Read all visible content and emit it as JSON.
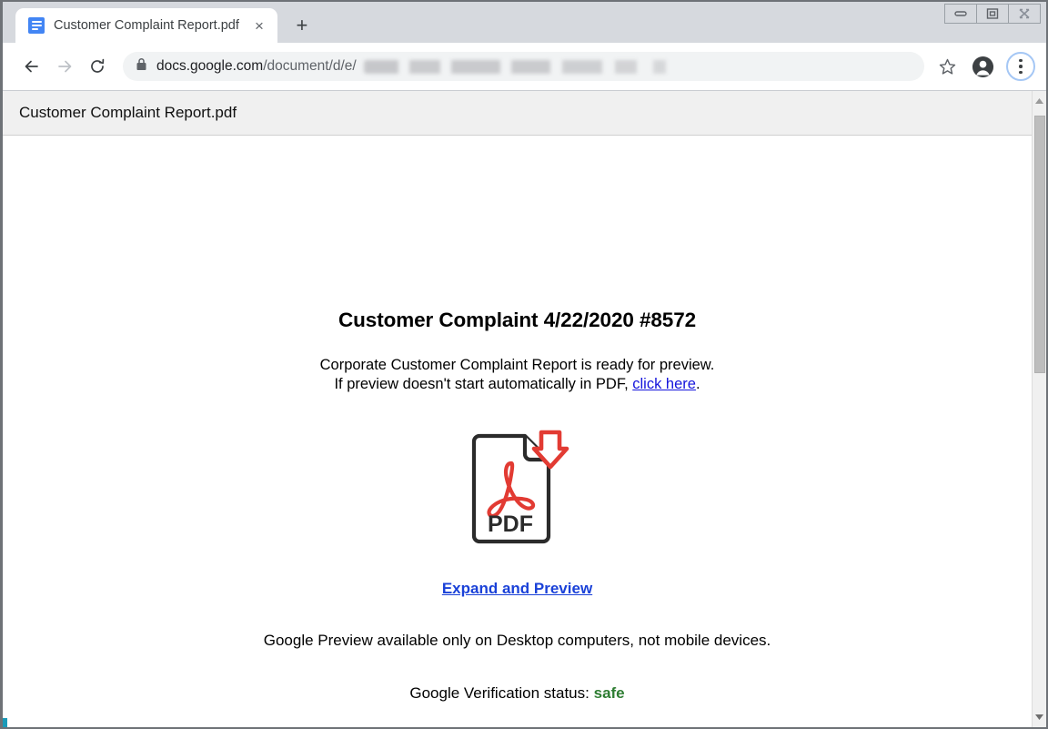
{
  "window": {
    "controls": [
      {
        "name": "minimize",
        "label": "Minimize"
      },
      {
        "name": "restore",
        "label": "Restore"
      },
      {
        "name": "close",
        "label": "Close"
      }
    ]
  },
  "browser": {
    "tab": {
      "title": "Customer Complaint Report.pdf",
      "favicon": "google-docs-icon",
      "close_label": "×"
    },
    "new_tab_label": "+",
    "nav": {
      "back_icon": "arrow-left-icon",
      "forward_icon": "arrow-right-icon",
      "reload_icon": "reload-icon"
    },
    "omnibox": {
      "lock_icon": "lock-icon",
      "url_host": "docs.google.com",
      "url_path": "/document/d/e/",
      "url_redacted": true
    },
    "bookmark_icon": "star-icon",
    "profile_icon": "account-avatar-icon",
    "menu_icon": "three-dot-menu-icon"
  },
  "viewer": {
    "title": "Customer Complaint Report.pdf"
  },
  "document": {
    "heading": "Customer Complaint 4/22/2020 #8572",
    "line1": "Corporate Customer Complaint Report is ready for preview.",
    "line2_prefix": "If preview doesn't start automatically in PDF, ",
    "line2_link": "click here",
    "line2_suffix": ".",
    "pdf_icon": {
      "name": "pdf-download-icon",
      "label": "PDF",
      "accent_color": "#e23b33",
      "outline_color": "#2b2b2b"
    },
    "expand_link": "Expand and Preview",
    "note": "Google Preview available only on Desktop computers, not mobile devices.",
    "status_label": "Google Verification status:",
    "status_value": "safe",
    "status_color": "#2e7d32"
  },
  "scrollbar": {
    "up_icon": "scroll-up-arrow-icon",
    "down_icon": "scroll-down-arrow-icon",
    "thumb_name": "scrollbar-thumb"
  }
}
